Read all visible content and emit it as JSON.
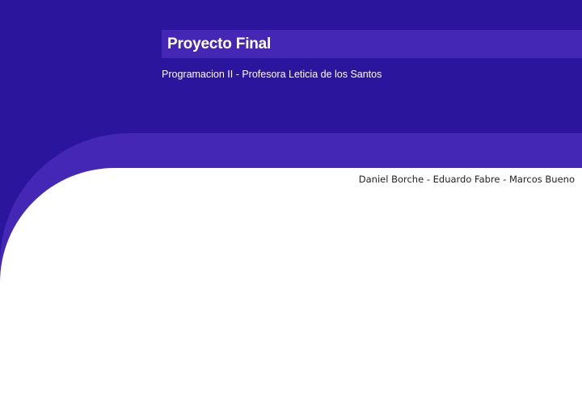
{
  "slide": {
    "title": "Proyecto Final",
    "subtitle": "Programacion II - Profesora Leticia de los Santos",
    "authors": "Daniel Borche - Eduardo Fabre - Marcos Bueno"
  },
  "colors": {
    "dark_background": "#2a159c",
    "accent_band": "#4427b5",
    "content_background": "#ffffff",
    "authors_text": "#222222"
  }
}
